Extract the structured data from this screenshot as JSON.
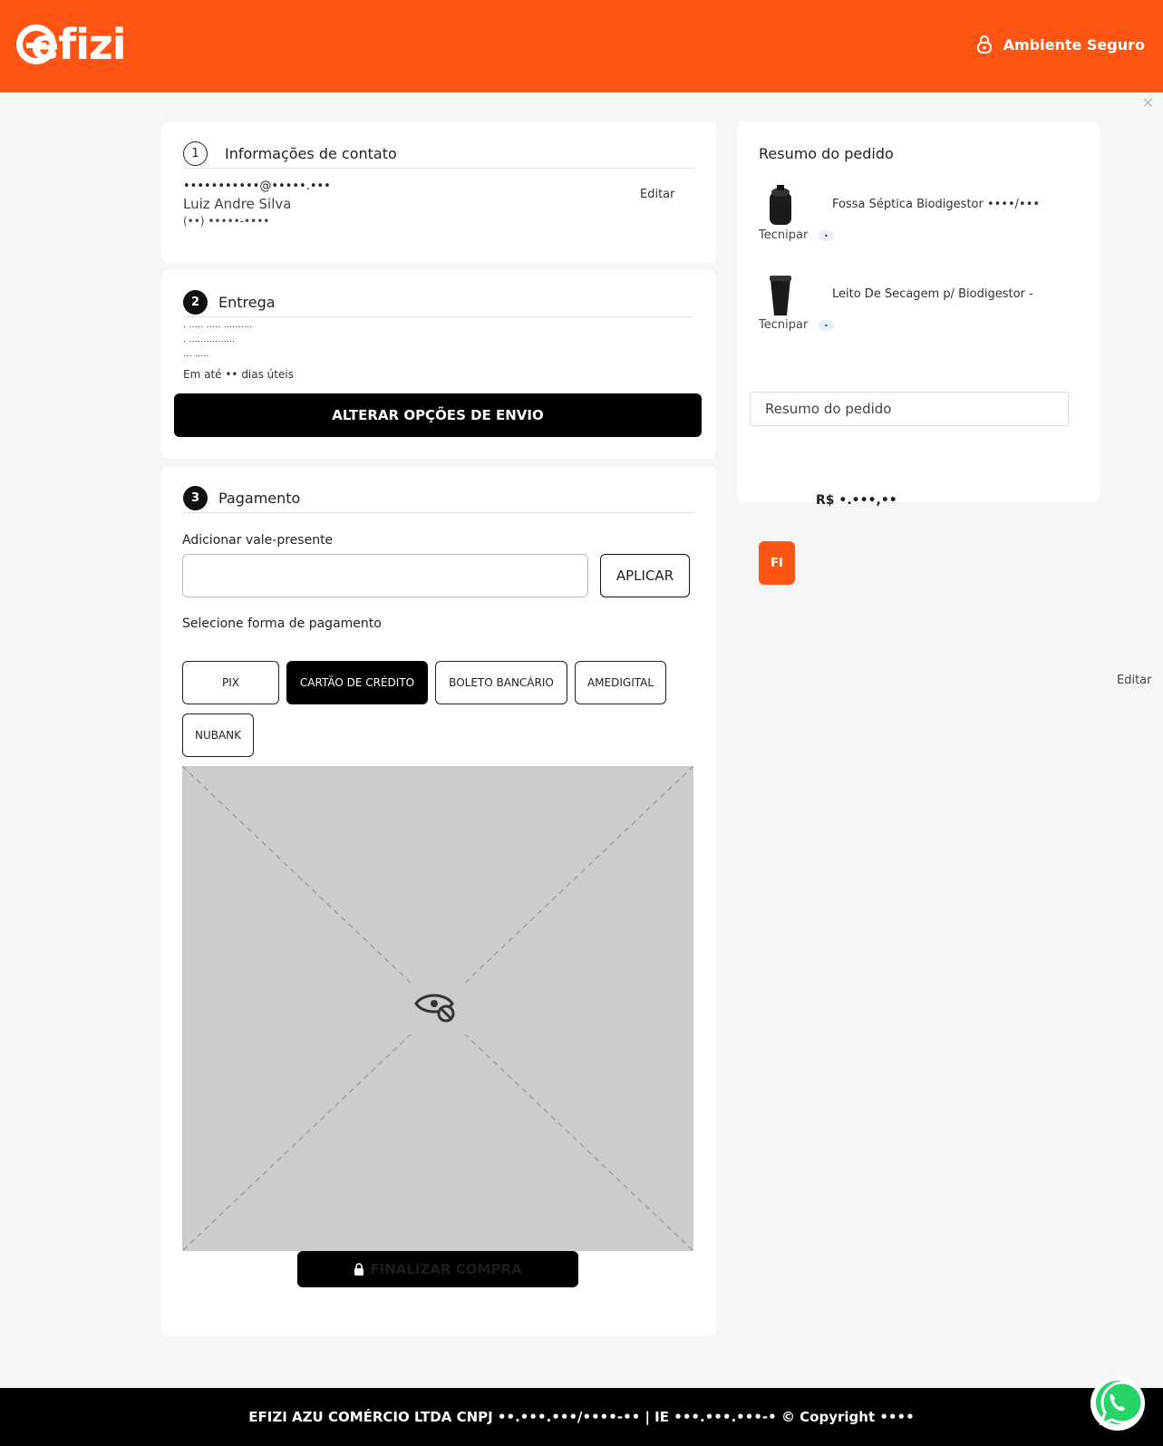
{
  "header": {
    "logo_text": "efizi",
    "secure_label": "Ambiente Seguro"
  },
  "contact": {
    "step_number": "1",
    "title": "Informações de contato",
    "email": "•••••••••••@•••••.•••",
    "name": "Luiz Andre Silva",
    "phone": "(••) •••••-••••",
    "edit_label": "Editar"
  },
  "delivery": {
    "step_number": "2",
    "title": "Entrega",
    "line1": "· ····· ····· ··········",
    "line2": "· ················",
    "line3": "··· ·····",
    "eta": "Em até •• dias úteis",
    "change_button": "ALTERAR OPÇÕES DE ENVIO"
  },
  "payment": {
    "step_number": "3",
    "title": "Pagamento",
    "gift_label": "Adicionar vale-presente",
    "gift_input_value": "",
    "apply_button": "APLICAR",
    "method_label": "Selecione forma de pagamento",
    "methods": [
      {
        "label": "PIX",
        "active": false
      },
      {
        "label": "CARTÃO DE CRÉDITO",
        "active": true
      },
      {
        "label": "BOLETO BANCÁRIO",
        "active": false
      },
      {
        "label": "AMEDIGITAL",
        "active": false
      },
      {
        "label": "NUBANK",
        "active": false
      }
    ],
    "finalize_button": "FINALIZAR COMPRA"
  },
  "summary": {
    "title": "Resumo do pedido",
    "items": [
      {
        "name": "Fossa Séptica Biodigestor ••••/•••",
        "brand": "Tecnipar",
        "badge": "•"
      },
      {
        "name": "Leito De Secagem p/ Biodigestor -",
        "brand": "Tecnipar",
        "badge": "•"
      }
    ],
    "summary_field": "Resumo do pedido",
    "total": "R$ •.•••,••",
    "orange_button": "FI",
    "edit_label": "Editar"
  },
  "footer": {
    "text": "EFIZI AZU COMÉRCIO LTDA CNPJ ••.•••.•••/••••-•• | IE •••.•••.•••-• © Copyright ••••"
  },
  "colors": {
    "brand": "#ff5514",
    "black": "#000000",
    "placeholder": "#cccccc"
  }
}
